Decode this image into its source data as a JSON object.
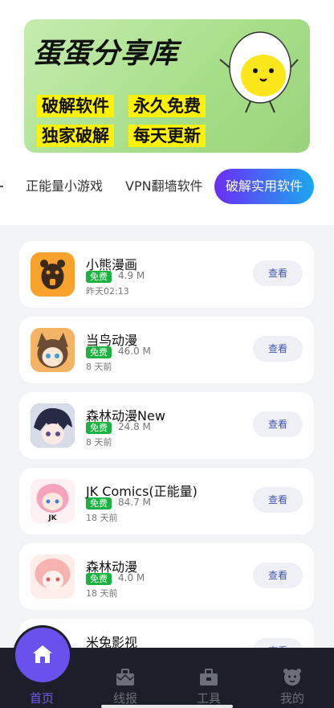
{
  "banner": {
    "title": "蛋蛋分享库",
    "tags": [
      "破解软件",
      "永久免费",
      "独家破解",
      "每天更新"
    ]
  },
  "tabs": {
    "items": [
      {
        "label": "正能量小游戏"
      },
      {
        "label": "VPN翻墙软件"
      },
      {
        "label": "破解实用软件"
      }
    ],
    "active_index": 2
  },
  "apps": [
    {
      "name": "小熊漫画",
      "badge": "免费",
      "size": "4.9 M",
      "date": "昨天02:13",
      "button": "查看",
      "icon": "bear-app-icon",
      "icon_color": "#f7a22a"
    },
    {
      "name": "当鸟动漫",
      "badge": "免费",
      "size": "46.0 M",
      "date": "8 天前",
      "button": "查看",
      "icon": "anime-girl-fox-icon",
      "icon_color": "#f0a850"
    },
    {
      "name": "森林动漫New",
      "badge": "免费",
      "size": "24.8 M",
      "date": "8 天前",
      "button": "查看",
      "icon": "anime-boy-icon",
      "icon_color": "#2c2f4a"
    },
    {
      "name": "JK Comics(正能量)",
      "badge": "免费",
      "size": "84.7 M",
      "date": "18 天前",
      "button": "查看",
      "icon": "jk-comics-icon",
      "icon_color": "#f6b8c8"
    },
    {
      "name": "森林动漫",
      "badge": "免费",
      "size": "4.0 M",
      "date": "18 天前",
      "button": "查看",
      "icon": "anime-pink-girl-icon",
      "icon_color": "#f8c9c9"
    },
    {
      "name": "米兔影视",
      "badge": "",
      "size": "",
      "date": "",
      "button": "查看",
      "icon": "mitu-video-icon",
      "icon_color": "#ffffff"
    }
  ],
  "nav": {
    "items": [
      {
        "label": "首页",
        "icon": "home-icon"
      },
      {
        "label": "线报",
        "icon": "briefcase-icon"
      },
      {
        "label": "工具",
        "icon": "toolbox-icon"
      },
      {
        "label": "我的",
        "icon": "profile-icon"
      }
    ],
    "active_index": 0,
    "active_color": "#6a50ec"
  }
}
